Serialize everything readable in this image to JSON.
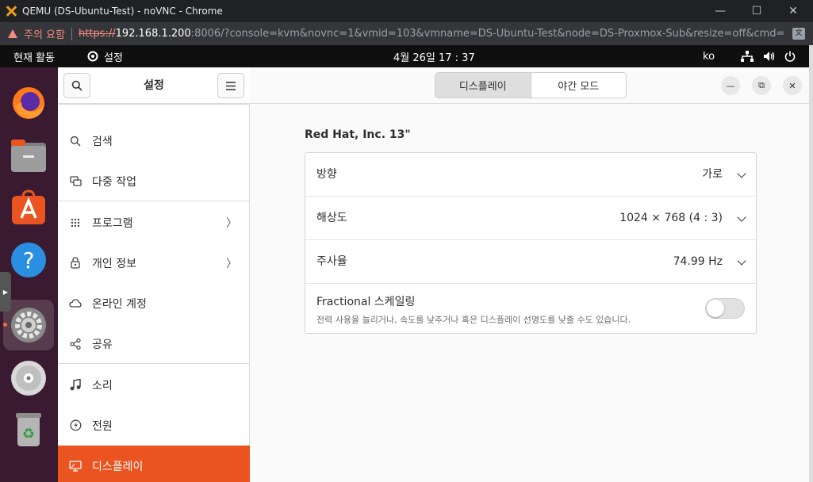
{
  "browser": {
    "window_title": "QEMU (DS-Ubuntu-Test) - noVNC - Chrome",
    "security_warning": "주의 요함",
    "url_scheme": "https://",
    "url_host": "192.168.1.200",
    "url_rest": ":8006/?console=kvm&novnc=1&vmid=103&vmname=DS-Ubuntu-Test&node=DS-Proxmox-Sub&resize=off&cmd=",
    "window_controls": {
      "minimize": "—",
      "maximize": "☐",
      "close": "✕"
    }
  },
  "topbar": {
    "activities": "현재 활동",
    "app_menu": "설정",
    "clock": "4월 26일  17 : 37",
    "input_method": "ko"
  },
  "dock": {
    "apps": [
      "firefox-icon",
      "files-icon",
      "software-icon",
      "help-icon",
      "settings-icon",
      "cd-icon",
      "trash-icon"
    ]
  },
  "sidebar": {
    "title": "설정",
    "items": [
      {
        "label": "검색",
        "icon": "search-icon",
        "chevron": ""
      },
      {
        "label": "다중 작업",
        "icon": "multitasking-icon",
        "chevron": ""
      },
      {
        "label": "프로그램",
        "icon": "apps-grid-icon",
        "chevron": "〉"
      },
      {
        "label": "개인 정보",
        "icon": "lock-icon",
        "chevron": "〉"
      },
      {
        "label": "온라인 계정",
        "icon": "cloud-icon",
        "chevron": ""
      },
      {
        "label": "공유",
        "icon": "share-icon",
        "chevron": ""
      },
      {
        "label": "소리",
        "icon": "music-note-icon",
        "chevron": ""
      },
      {
        "label": "전원",
        "icon": "power-icon",
        "chevron": ""
      },
      {
        "label": "디스플레이",
        "icon": "display-icon",
        "chevron": ""
      }
    ]
  },
  "main": {
    "tabs": [
      {
        "label": "디스플레이"
      },
      {
        "label": "야간 모드"
      }
    ],
    "monitor_name": "Red Hat, Inc. 13\"",
    "rows": [
      {
        "label": "방향",
        "value": "가로"
      },
      {
        "label": "해상도",
        "value": "1024 × 768 (4 : 3)"
      },
      {
        "label": "주사율",
        "value": "74.99 Hz"
      }
    ],
    "fractional": {
      "label": "Fractional 스케일링",
      "description": "전력 사용을 늘리거나, 속도를 낮추거나 혹은 디스플레이 선명도를 낮출 수도 있습니다.",
      "enabled": false
    },
    "window_controls": {
      "minimize": "—",
      "restore": "⧉",
      "close": "✕"
    }
  },
  "colors": {
    "accent": "#e95420",
    "dock_bg": "#3a1a30",
    "warning": "#f28b82"
  }
}
